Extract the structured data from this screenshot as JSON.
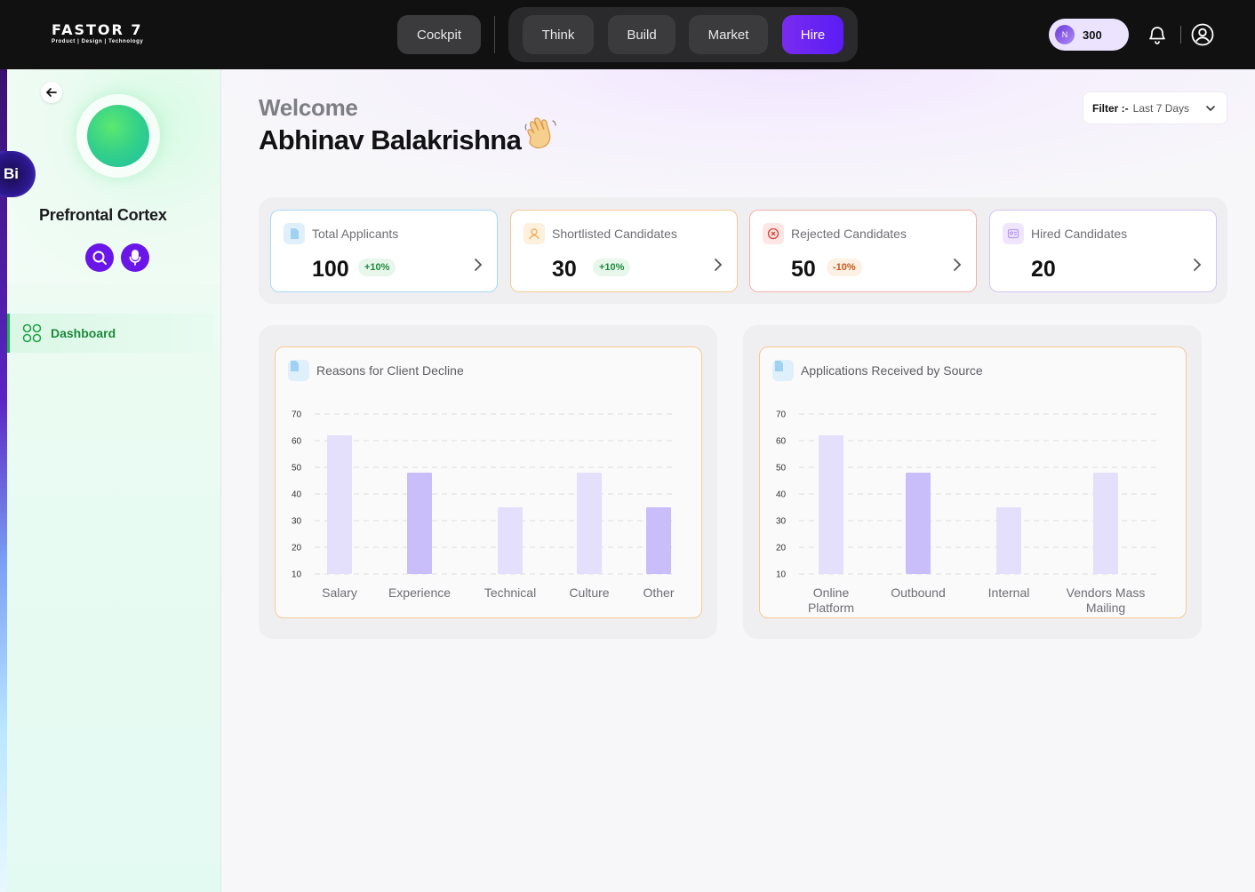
{
  "app": {
    "brand": "FASTOR 7",
    "tagline": "Product | Design | Technology"
  },
  "topnav": {
    "cockpit": "Cockpit",
    "tabs": [
      {
        "label": "Think",
        "active": false
      },
      {
        "label": "Build",
        "active": false
      },
      {
        "label": "Market",
        "active": false
      },
      {
        "label": "Hire",
        "active": true
      }
    ],
    "credits": {
      "coin": "N",
      "value": "300"
    }
  },
  "sidebar": {
    "badge": "Bi",
    "title": "Prefrontal Cortex",
    "menu": [
      {
        "label": "Dashboard",
        "icon": "grid-icon",
        "active": true
      }
    ]
  },
  "header": {
    "welcome": "Welcome",
    "user": "Abhinav Balakrishna",
    "filter_key": "Filter :-",
    "filter_value": "Last 7 Days"
  },
  "kpis": [
    {
      "label": "Total Applicants",
      "value": "100",
      "change": "+10%",
      "trend": "up",
      "icon": "document-icon",
      "color": "#a9d8f5"
    },
    {
      "label": "Shortlisted Candidates",
      "value": "30",
      "change": "+10%",
      "trend": "up",
      "icon": "user-icon",
      "color": "#f5c992"
    },
    {
      "label": "Rejected Candidates",
      "value": "50",
      "change": "-10%",
      "trend": "down",
      "icon": "x-circle-icon",
      "color": "#f2b0a8"
    },
    {
      "label": "Hired Candidates",
      "value": "20",
      "change": "",
      "trend": "none",
      "icon": "id-card-icon",
      "color": "#d6c2f5"
    }
  ],
  "chart_data": [
    {
      "type": "bar",
      "title": "Reasons for Client Decline",
      "categories": [
        "Salary",
        "Experience",
        "Technical",
        "Culture",
        "Other"
      ],
      "values": [
        62,
        48,
        35,
        48,
        35
      ],
      "highlight": [
        false,
        true,
        false,
        false,
        true
      ],
      "yticks": [
        10,
        20,
        30,
        40,
        50,
        60,
        70
      ],
      "ylim": [
        10,
        70
      ],
      "grid": true,
      "colors": {
        "bar": "#e4e0fb",
        "highlight": "#c9befa"
      }
    },
    {
      "type": "bar",
      "title": "Applications Received by Source",
      "categories": [
        "Online Platform",
        "Outbound",
        "Internal",
        "Vendors Mass Mailing"
      ],
      "values": [
        62,
        48,
        35,
        48
      ],
      "highlight": [
        false,
        true,
        false,
        false
      ],
      "yticks": [
        10,
        20,
        30,
        40,
        50,
        60,
        70
      ],
      "ylim": [
        10,
        70
      ],
      "grid": true,
      "colors": {
        "bar": "#e4e0fb",
        "highlight": "#c9befa"
      }
    }
  ]
}
